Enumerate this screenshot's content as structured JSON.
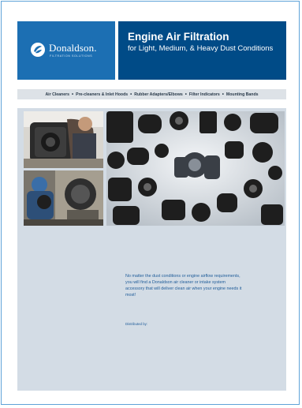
{
  "brand": {
    "name": "Donaldson.",
    "tagline": "FILTRATION SOLUTIONS",
    "logo_icon": "donaldson-leaf-logo",
    "color": "#1c6fb3"
  },
  "header": {
    "title": "Engine Air Filtration",
    "subtitle": "for Light, Medium, & Heavy Dust Conditions",
    "background": "#004b87"
  },
  "nav": {
    "items": [
      "Air Cleaners",
      "Pre-cleaners & Inlet Hoods",
      "Rubber Adapters/Elbows",
      "Filter Indicators",
      "Mounting Bands"
    ],
    "separator": "•"
  },
  "body": {
    "tagline": "No matter the dust conditions or engine airflow requirements, you will find a Donaldson air cleaner or intake system accessory that will deliver clean air when your engine needs it most!",
    "distributed_by": "Distributed by:"
  }
}
